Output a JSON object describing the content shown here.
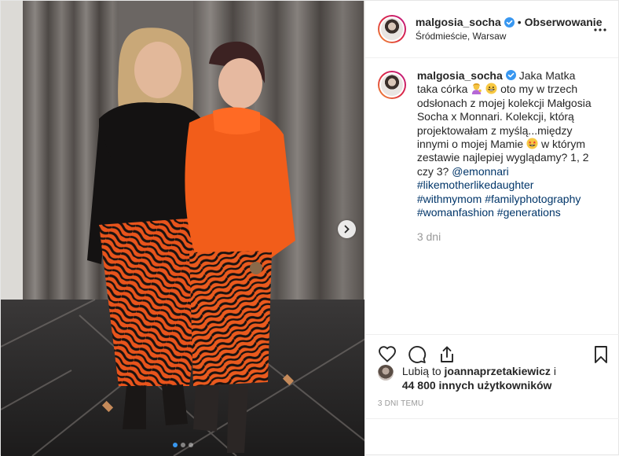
{
  "post": {
    "username": "malgosia_socha",
    "verified_icon": "verified-badge-icon",
    "follow_label": "Obserwowanie",
    "separator": "•",
    "location": "Śródmieście, Warsaw",
    "more_icon": "more-options-icon"
  },
  "caption": {
    "username": "malgosia_socha",
    "part1": "Jaka Matka taka córka",
    "emoji1": "woman-tipping-hand-emoji",
    "emoji2": "grinning-face-emoji",
    "part2": "oto my w trzech odsłonach z mojej kolekcji Małgosia Socha x Monnari. Kolekcji, którą projektowałam z myślą...między innymi o mojej Mamie",
    "emoji3": "star-struck-emoji",
    "part3": "w którym zestawie najlepiej wyglądamy? 1, 2 czy 3?",
    "mention": "@emonnari",
    "hashtags": [
      "#likemotherlikedaughter",
      "#withmymom",
      "#familyphotography",
      "#womanfashion",
      "#generations"
    ],
    "age": "3 dni"
  },
  "actions": {
    "like_icon": "heart-icon",
    "comment_icon": "comment-icon",
    "share_icon": "share-icon",
    "save_icon": "bookmark-icon"
  },
  "likes": {
    "prefix": "Lubią to",
    "liker": "joannaprzetakiewicz",
    "joiner": "i",
    "others": "44 800 innych użytkowników"
  },
  "timestamp": "3 DNI TEMU",
  "carousel": {
    "slides": 3,
    "active": 1,
    "next_icon": "chevron-right-icon"
  },
  "colors": {
    "accent_blue": "#3897f0",
    "link_blue": "#003569",
    "muted": "#999999",
    "text": "#262626"
  }
}
